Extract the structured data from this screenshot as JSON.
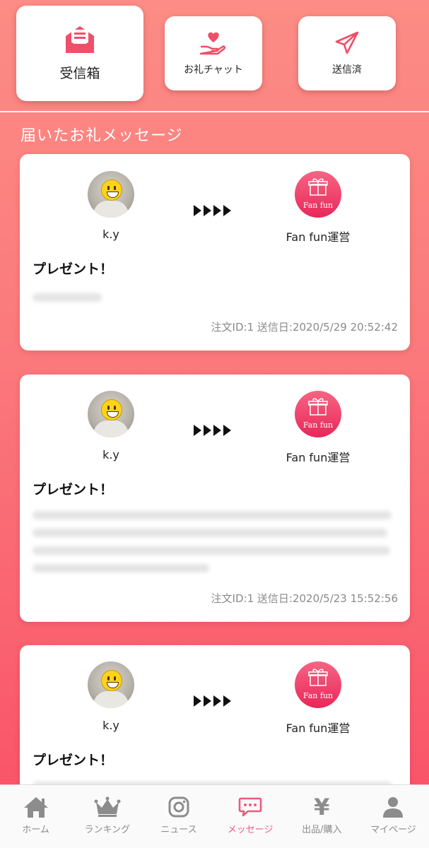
{
  "top_tabs": {
    "inbox_label": "受信箱",
    "chat_label": "お礼チャット",
    "sent_label": "送信済"
  },
  "section_title": "届いたお礼メッセージ",
  "messages": [
    {
      "from_name": "k.y",
      "to_name": "Fan fun運営",
      "logo_text": "Fan fun",
      "title": "プレゼント！",
      "meta": "注文ID:1 送信日:2020/5/29 20:52:42"
    },
    {
      "from_name": "k.y",
      "to_name": "Fan fun運営",
      "logo_text": "Fan fun",
      "title": "プレゼント！",
      "meta": "注文ID:1 送信日:2020/5/23 15:52:56"
    },
    {
      "from_name": "k.y",
      "to_name": "Fan fun運営",
      "logo_text": "Fan fun",
      "title": "プレゼント！",
      "meta": ""
    }
  ],
  "tabbar": {
    "items": [
      {
        "label": "ホーム",
        "icon": "home-icon"
      },
      {
        "label": "ランキング",
        "icon": "crown-icon"
      },
      {
        "label": "ニュース",
        "icon": "instagram-icon"
      },
      {
        "label": "メッセージ",
        "icon": "chat-bubble-icon"
      },
      {
        "label": "出品/購入",
        "icon": "yen-icon",
        "glyph": "¥"
      },
      {
        "label": "マイページ",
        "icon": "person-icon"
      }
    ],
    "active_index": 3
  },
  "colors": {
    "accent": "#f4577e",
    "background_top": "#fc8c85",
    "background_bottom": "#f94f66",
    "icon_red": "#ef4f67"
  }
}
